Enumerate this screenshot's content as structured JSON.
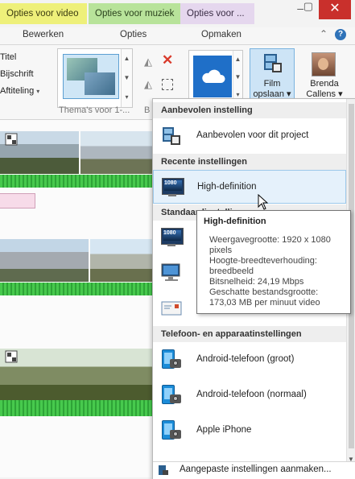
{
  "ctx_tabs": {
    "video": "Opties voor video",
    "music": "Opties voor muziek",
    "project": "Opties voor ..."
  },
  "window": {
    "minimize": "–",
    "maximize": "▢",
    "close": "✕"
  },
  "ribbon_tabs": {
    "bewerken": "Bewerken",
    "opties": "Opties",
    "opmaken": "Opmaken",
    "help": "?",
    "collapse": "⌃"
  },
  "text_group": {
    "titel": "Titel",
    "bijschrift": "Bijschrift",
    "aftiteling": "Aftiteling",
    "aftiteling_arrow": "▾"
  },
  "themes": {
    "label": "Thema's voor 1-...",
    "scroll_up": "▲",
    "scroll_down": "▼",
    "scroll_more": "▾",
    "b_label": "B"
  },
  "edit_icons": {
    "rotate_left": "◭",
    "delete": "✕",
    "rotate_right": "◭"
  },
  "onedrive": {
    "scroll_up": "▲",
    "scroll_down": "▼",
    "scroll_more": "▾"
  },
  "save": {
    "line1": "Film",
    "line2": "opslaan ▾"
  },
  "account": {
    "line1": "Brenda",
    "line2": "Callens ▾"
  },
  "menu": {
    "sections": {
      "recommended": "Aanbevolen instelling",
      "recent": "Recente instellingen",
      "standard": "Standaardinstellingen",
      "phone": "Telefoon- en apparaatinstellingen"
    },
    "items": {
      "recommended": "Aanbevolen voor dit project",
      "recent_hd": "High-definition",
      "android_large": "Android-telefoon (groot)",
      "android_normal": "Android-telefoon (normaal)",
      "iphone": "Apple iPhone"
    },
    "monitor_badge": "1080",
    "footer": "Aangepaste instellingen aanmaken...",
    "scroll_down": "▼"
  },
  "tooltip": {
    "title": "High-definition",
    "line1": "Weergavegrootte: 1920 x 1080 pixels",
    "line2": "Hoogte-breedteverhouding: breedbeeld",
    "line3": "Bitsnelheid: 24,19 Mbps",
    "line4": "Geschatte bestandsgrootte: 173,03 MB per minuut video"
  }
}
